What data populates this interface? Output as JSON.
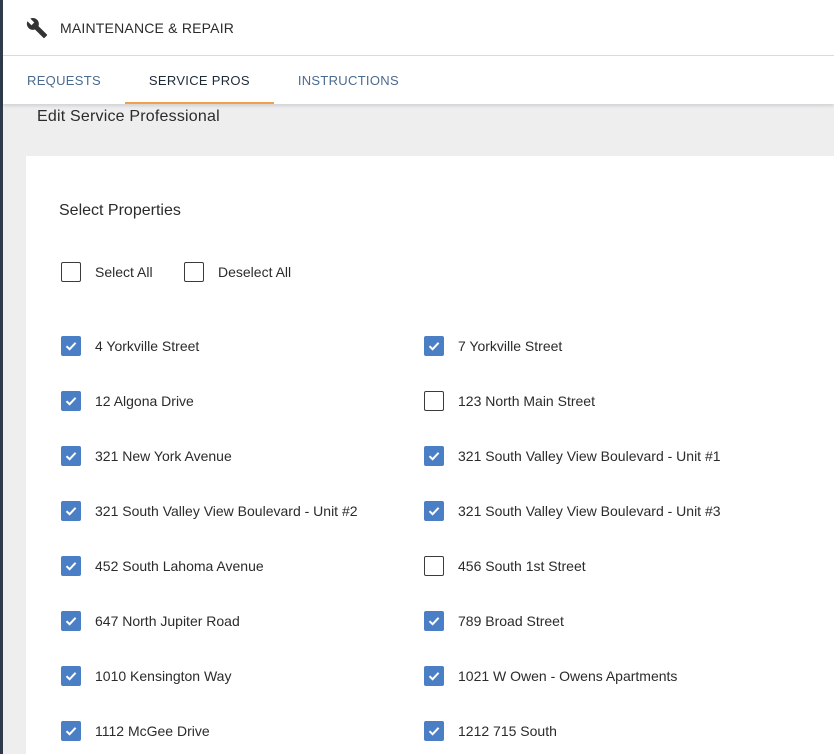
{
  "header": {
    "title": "MAINTENANCE & REPAIR",
    "icon": "wrench-icon"
  },
  "tabs": [
    {
      "label": "REQUESTS",
      "active": false
    },
    {
      "label": "SERVICE PROS",
      "active": true
    },
    {
      "label": "INSTRUCTIONS",
      "active": false
    }
  ],
  "page": {
    "title": "Edit Service Professional"
  },
  "properties": {
    "section_title": "Select Properties",
    "select_all_label": "Select All",
    "deselect_all_label": "Deselect All",
    "select_all_checked": false,
    "deselect_all_checked": false,
    "items": [
      {
        "label": "4 Yorkville Street",
        "checked": true
      },
      {
        "label": "7 Yorkville Street",
        "checked": true
      },
      {
        "label": "12 Algona Drive",
        "checked": true
      },
      {
        "label": "123 North Main Street",
        "checked": false
      },
      {
        "label": "321 New York Avenue",
        "checked": true
      },
      {
        "label": "321 South Valley View Boulevard - Unit #1",
        "checked": true
      },
      {
        "label": "321 South Valley View Boulevard - Unit #2",
        "checked": true
      },
      {
        "label": "321 South Valley View Boulevard - Unit #3",
        "checked": true
      },
      {
        "label": "452 South Lahoma Avenue",
        "checked": true
      },
      {
        "label": "456 South 1st Street",
        "checked": false
      },
      {
        "label": "647 North Jupiter Road",
        "checked": true
      },
      {
        "label": "789 Broad Street",
        "checked": true
      },
      {
        "label": "1010 Kensington Way",
        "checked": true
      },
      {
        "label": "1021 W Owen - Owens Apartments",
        "checked": true
      },
      {
        "label": "1112 McGee Drive",
        "checked": true
      },
      {
        "label": "1212 715 South",
        "checked": true
      }
    ]
  },
  "colors": {
    "accent_checkbox": "#4a7fc5",
    "tab_text": "#4a6b8f",
    "tab_active_underline": "#f0a04b",
    "page_background": "#eeeeef",
    "sidebar_edge": "#2f3a4a"
  }
}
